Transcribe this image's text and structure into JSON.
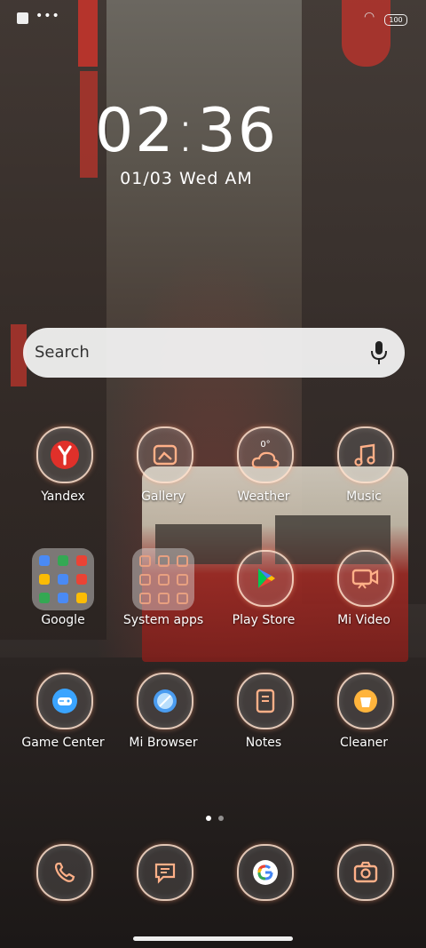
{
  "status_bar": {
    "battery": "100"
  },
  "clock": {
    "hours": "02",
    "minutes": "36"
  },
  "date": {
    "text": "01/03 Wed AM"
  },
  "search": {
    "placeholder": "Search"
  },
  "apps": [
    {
      "label": "Yandex"
    },
    {
      "label": "Gallery"
    },
    {
      "label": "Weather",
      "badge": "0°"
    },
    {
      "label": "Music"
    },
    {
      "label": "Google"
    },
    {
      "label": "System apps"
    },
    {
      "label": "Play Store"
    },
    {
      "label": "Mi Video"
    },
    {
      "label": "Game Center"
    },
    {
      "label": "Mi Browser"
    },
    {
      "label": "Notes"
    },
    {
      "label": "Cleaner"
    }
  ],
  "dock": [
    {
      "icon": "phone-icon"
    },
    {
      "icon": "messages-icon"
    },
    {
      "icon": "google-icon"
    },
    {
      "icon": "camera-icon"
    }
  ],
  "colors": {
    "accent": "#ff9a6a",
    "red": "#e0302a"
  }
}
